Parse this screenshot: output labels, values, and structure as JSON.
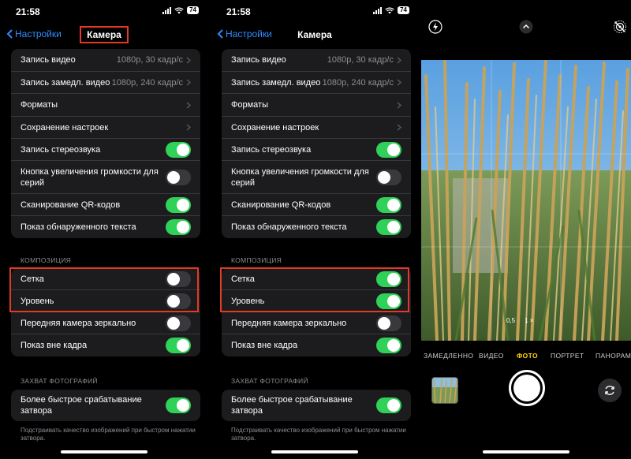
{
  "status": {
    "time": "21:58",
    "battery": "74"
  },
  "nav": {
    "back_label": "Настройки",
    "title": "Камера"
  },
  "settings": {
    "video_record": {
      "label": "Запись видео",
      "value": "1080p, 30 кадр/с"
    },
    "slomo_record": {
      "label": "Запись замедл. видео",
      "value": "1080p, 240 кадр/с"
    },
    "formats": {
      "label": "Форматы"
    },
    "preserve": {
      "label": "Сохранение настроек"
    },
    "stereo": {
      "label": "Запись стереозвука"
    },
    "volume_burst": {
      "label": "Кнопка увеличения громкости для серий"
    },
    "qr_scan": {
      "label": "Сканирование QR-кодов"
    },
    "show_text": {
      "label": "Показ обнаруженного текста"
    },
    "composition_header": "КОМПОЗИЦИЯ",
    "grid": {
      "label": "Сетка"
    },
    "level": {
      "label": "Уровень"
    },
    "mirror_front": {
      "label": "Передняя камера зеркально"
    },
    "view_outside": {
      "label": "Показ вне кадра"
    },
    "capture_header": "ЗАХВАТ ФОТОГРАФИЙ",
    "faster_shutter": {
      "label": "Более быстрое срабатывание затвора"
    },
    "footnote": "Подстраивать качество изображений при быстром нажатии затвора."
  },
  "panel_left": {
    "stereo": true,
    "volume_burst": false,
    "qr_scan": true,
    "show_text": true,
    "grid": false,
    "level": false,
    "mirror_front": false,
    "view_outside": true,
    "faster_shutter": true
  },
  "panel_right": {
    "stereo": true,
    "volume_burst": false,
    "qr_scan": true,
    "show_text": true,
    "grid": true,
    "level": true,
    "mirror_front": false,
    "view_outside": true,
    "faster_shutter": true
  },
  "camera": {
    "zoom_options": [
      "0,5",
      "1 ×"
    ],
    "modes": [
      "ЗАМЕДЛЕННО",
      "ВИДЕО",
      "ФОТО",
      "ПОРТРЕТ",
      "ПАНОРАМА"
    ],
    "selected_mode": "ФОТО"
  },
  "colors": {
    "accent_blue": "#2f8cff",
    "toggle_on": "#30d158",
    "highlight_red": "#e13b27",
    "mode_selected": "#ffd60a"
  }
}
